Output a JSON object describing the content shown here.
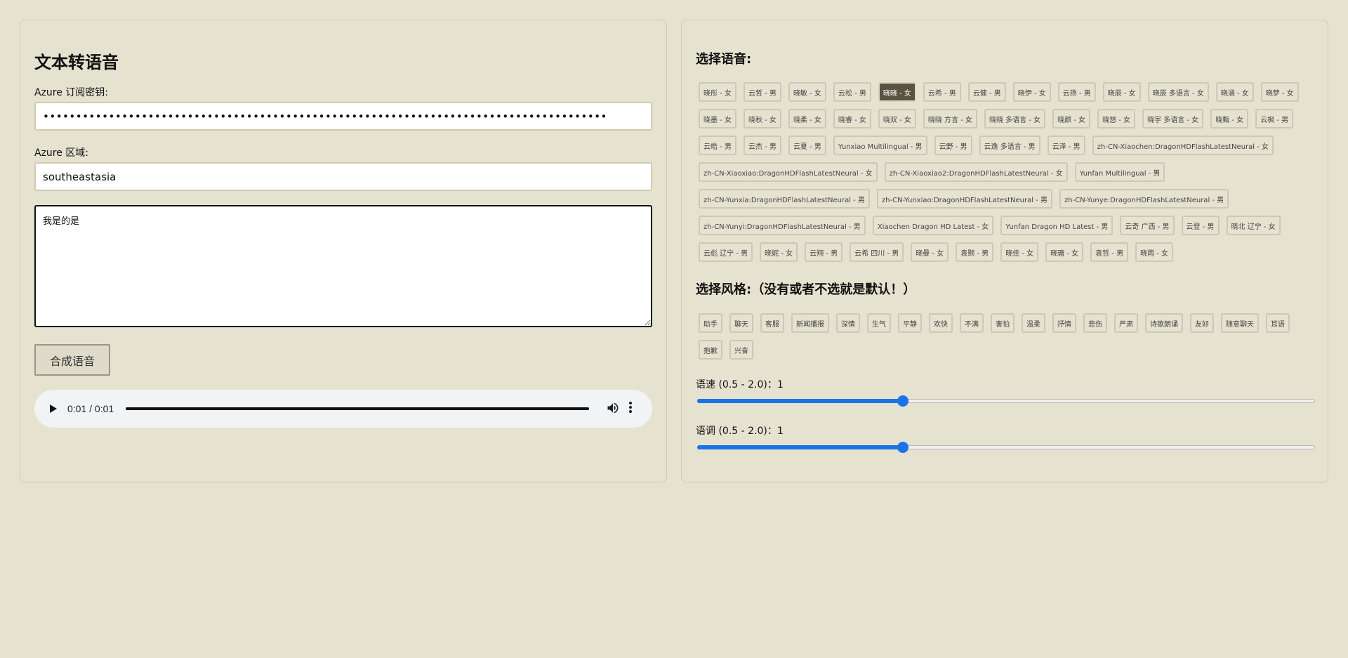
{
  "left": {
    "title": "文本转语音",
    "key_label": "Azure 订阅密钥:",
    "key_value": "••••••••••••••••••••••••••••••••••••••••••••••••••••••••••••••••••••••••••••••••••••••",
    "region_label": "Azure 区域:",
    "region_value": "southeastasia",
    "text_value": "我是的是",
    "synth_button": "合成语音",
    "audio": {
      "time": "0:01 / 0:01",
      "progress_fraction": 1.0
    }
  },
  "right": {
    "voice_heading": "选择语音:",
    "voices": [
      "晓彤 - 女",
      "云哲 - 男",
      "晓敏 - 女",
      "云松 - 男",
      "晓晓 - 女",
      "云希 - 男",
      "云健 - 男",
      "晓伊 - 女",
      "云扬 - 男",
      "晓辰 - 女",
      "晓辰 多语言 - 女",
      "晓涵 - 女",
      "晓梦 - 女",
      "晓墨 - 女",
      "晓秋 - 女",
      "晓柔 - 女",
      "晓睿 - 女",
      "晓双 - 女",
      "晓晓 方言 - 女",
      "晓晓 多语言 - 女",
      "晓颜 - 女",
      "晓悠 - 女",
      "晓宇 多语言 - 女",
      "晓甄 - 女",
      "云枫 - 男",
      "云皓 - 男",
      "云杰 - 男",
      "云夏 - 男",
      "Yunxiao Multilingual - 男",
      "云野 - 男",
      "云逸 多语言 - 男",
      "云泽 - 男",
      "zh-CN-Xiaochen:DragonHDFlashLatestNeural - 女",
      "zh-CN-Xiaoxiao:DragonHDFlashLatestNeural - 女",
      "zh-CN-Xiaoxiao2:DragonHDFlashLatestNeural - 女",
      "Yunfan Multilingual - 男",
      "zh-CN-Yunxia:DragonHDFlashLatestNeural - 男",
      "zh-CN-Yunxiao:DragonHDFlashLatestNeural - 男",
      "zh-CN-Yunye:DragonHDFlashLatestNeural - 男",
      "zh-CN-Yunyi:DragonHDFlashLatestNeural - 男",
      "Xiaochen Dragon HD Latest - 女",
      "Yunfan Dragon HD Latest - 男",
      "云奇 广西 - 男",
      "云登 - 男",
      "晓北 辽宁 - 女",
      "云彪 辽宁 - 男",
      "晓妮 - 女",
      "云翔 - 男",
      "云希 四川 - 男",
      "晓曼 - 女",
      "袁颢 - 男",
      "晓佳 - 女",
      "晓瑭 - 女",
      "袁哲 - 男",
      "晓雨 - 女"
    ],
    "selected_voice": 4,
    "style_heading": "选择风格:（没有或者不选就是默认！）",
    "styles": [
      "助手",
      "聊天",
      "客服",
      "新闻播报",
      "深情",
      "生气",
      "平静",
      "欢快",
      "不满",
      "害怕",
      "温柔",
      "抒情",
      "悲伤",
      "严肃",
      "诗歌朗诵",
      "友好",
      "随意聊天",
      "耳语",
      "抱歉",
      "兴奋"
    ],
    "rate_label": "语速 (0.5 - 2.0)：1",
    "rate": {
      "min": 0.5,
      "max": 2.0,
      "value": 1
    },
    "pitch_label": "语调 (0.5 - 2.0)：1",
    "pitch": {
      "min": 0.5,
      "max": 2.0,
      "value": 1
    }
  },
  "colors": {
    "background": "#e5e2d0",
    "selected_chip": "#5a5340",
    "slider_accent": "#1a73e8"
  },
  "icons": {
    "play": "play-icon",
    "volume": "volume-icon",
    "more": "more-vertical-icon"
  }
}
